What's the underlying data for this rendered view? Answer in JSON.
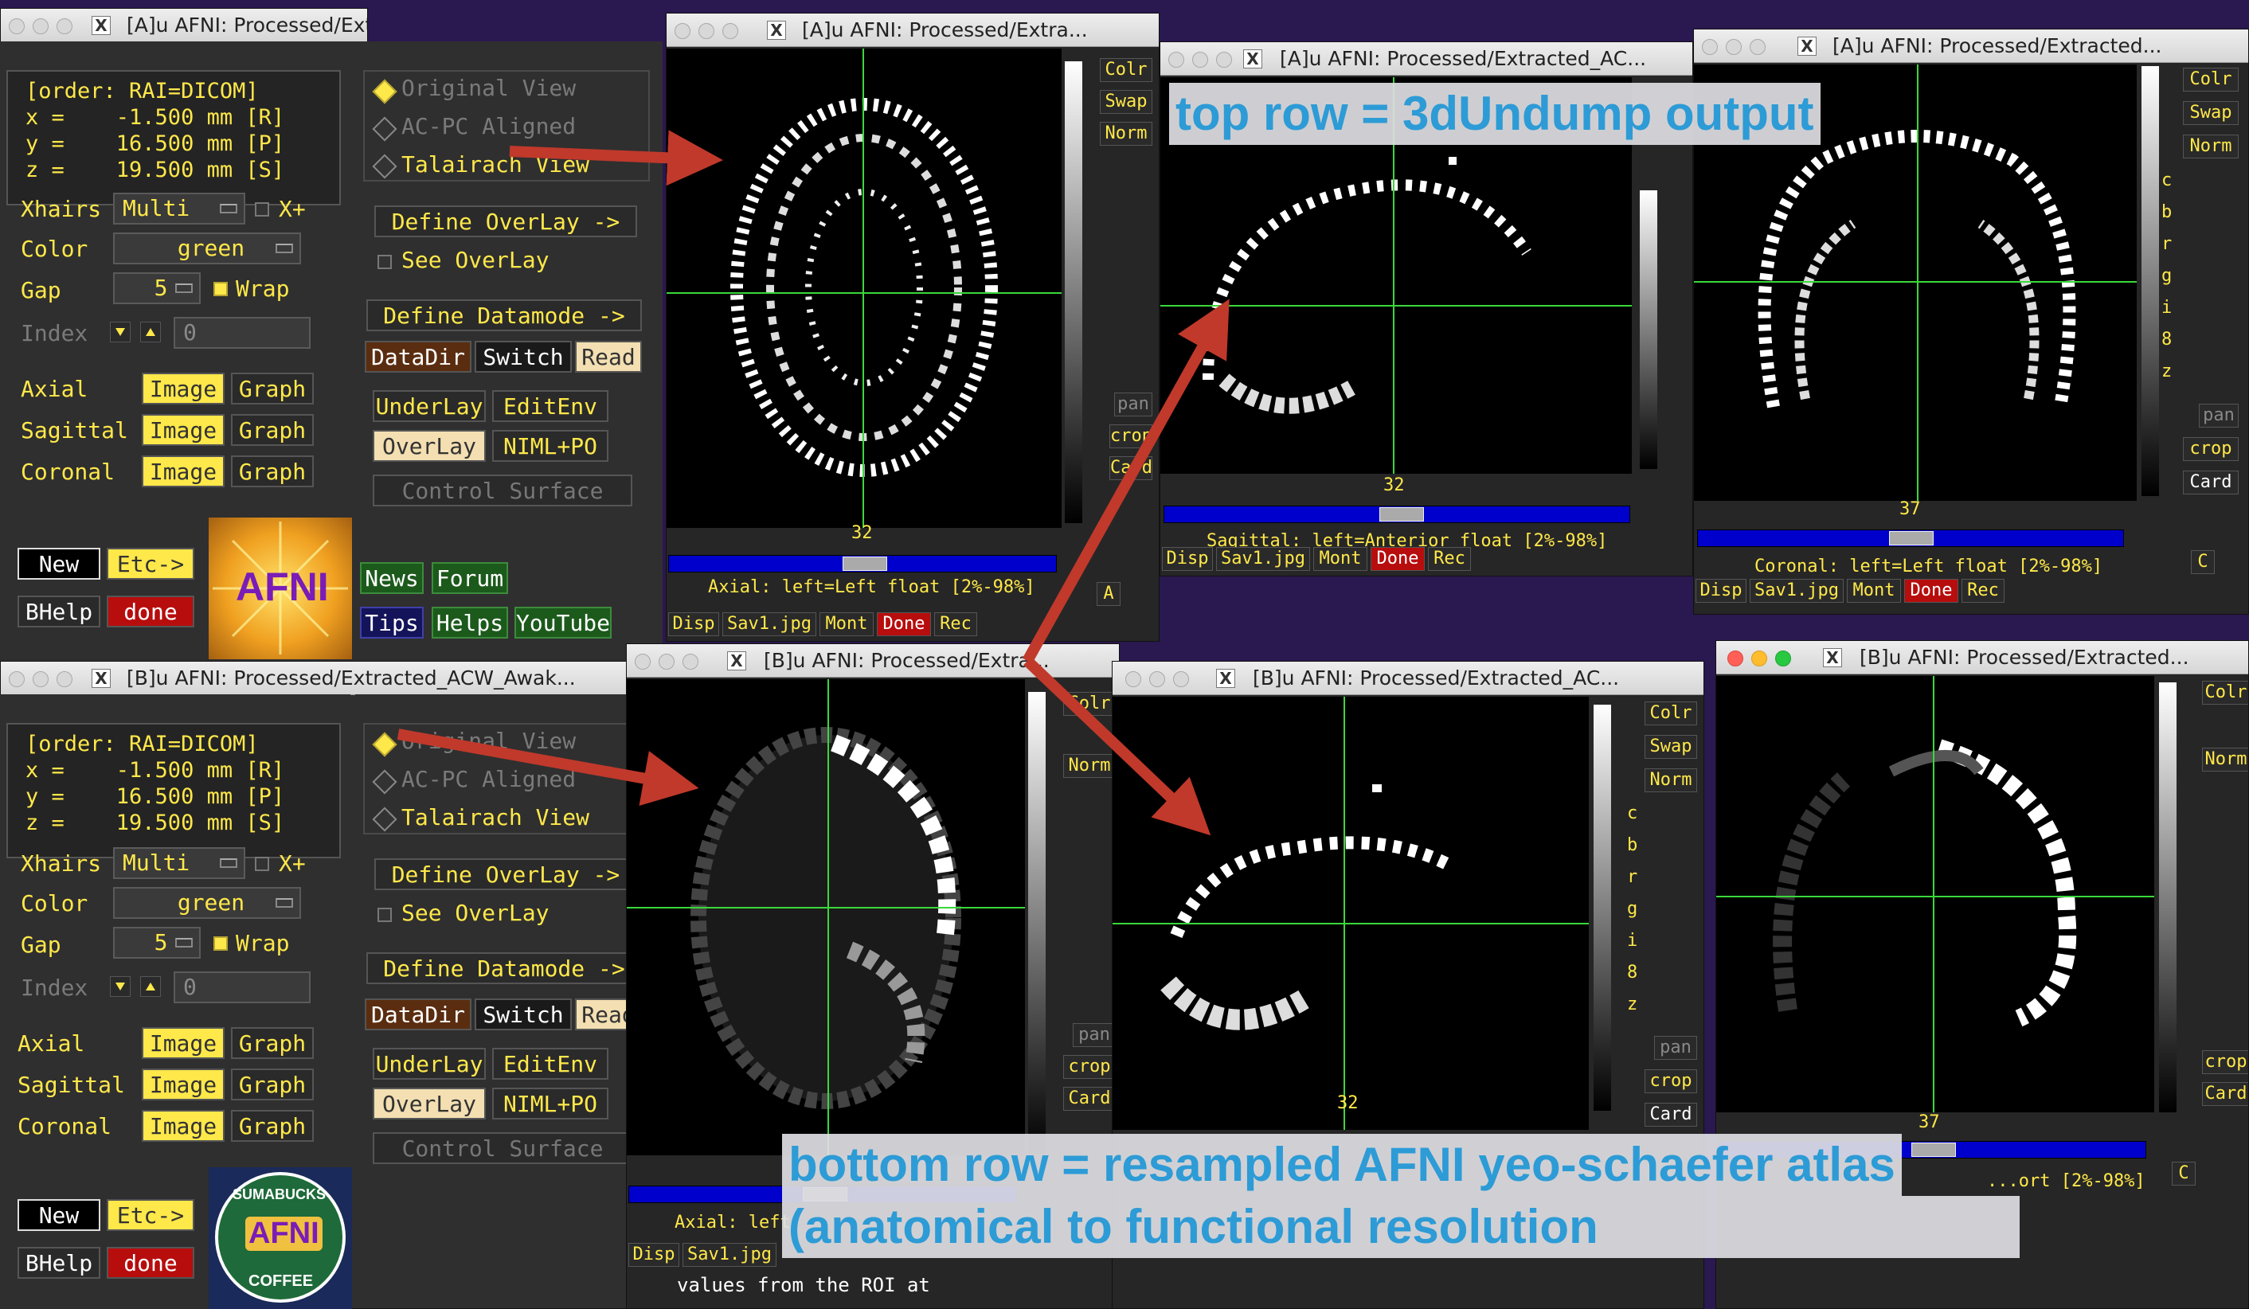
{
  "annotations": {
    "top_row": "top row = 3dUndump output",
    "bottom_row_line1": "bottom row = resampled AFNI yeo-schaefer atlas",
    "bottom_row_line2": "(anatomical to functional resolution"
  },
  "controllers": [
    {
      "title": "[A]u AFNI: Processed/Extracted_ACW_Awak...",
      "coords": "[order: RAI=DICOM]\nx =    -1.500 mm [R]\ny =    16.500 mm [P]\nz =    19.500 mm [S]",
      "xhairs_label": "Xhairs",
      "xhairs_value": "Multi",
      "xplus": "X+",
      "color_label": "Color",
      "color_value": "green",
      "gap_label": "Gap",
      "gap_value": "5",
      "wrap": "Wrap",
      "index_label": "Index",
      "index_value": "0",
      "axial": "Axial",
      "sagittal": "Sagittal",
      "coronal": "Coronal",
      "image": "Image",
      "graph": "Graph",
      "original_view": "Original View",
      "acpc_view": "AC-PC Aligned",
      "talairach_view": "Talairach View",
      "define_overlay": "Define OverLay ->",
      "see_overlay": "See OverLay",
      "define_datamode": "Define Datamode ->",
      "datadir": "DataDir",
      "switch": "Switch",
      "read": "Read",
      "underlay": "UnderLay",
      "editenv": "EditEnv",
      "overlay": "OverLay",
      "niml": "NIML+PO",
      "control_surface": "Control Surface",
      "new": "New",
      "etc": "Etc->",
      "bhelp": "BHelp",
      "done": "done",
      "logo_text": "AFNI"
    },
    {
      "title": "[B]u AFNI: Processed/Extracted_ACW_Awak...",
      "coords": "[order: RAI=DICOM]\nx =    -1.500 mm [R]\ny =    16.500 mm [P]\nz =    19.500 mm [S]",
      "xhairs_label": "Xhairs",
      "xhairs_value": "Multi",
      "xplus": "X+",
      "color_label": "Color",
      "color_value": "green",
      "gap_label": "Gap",
      "gap_value": "5",
      "wrap": "Wrap",
      "index_label": "Index",
      "index_value": "0",
      "axial": "Axial",
      "sagittal": "Sagittal",
      "coronal": "Coronal",
      "image": "Image",
      "graph": "Graph",
      "original_view": "Original View",
      "acpc_view": "AC-PC Aligned",
      "talairach_view": "Talairach View",
      "define_overlay": "Define OverLay ->",
      "see_overlay": "See OverLay",
      "define_datamode": "Define Datamode ->",
      "datadir": "DataDir",
      "switch": "Switch",
      "read": "Read",
      "underlay": "UnderLay",
      "editenv": "EditEnv",
      "overlay": "OverLay",
      "niml": "NIML+PO",
      "control_surface": "Control Surface",
      "new": "New",
      "etc": "Etc->",
      "bhelp": "BHelp",
      "done": "done",
      "logo_top": "SUMABUCKS",
      "logo_mid": "AFNI",
      "logo_bottom": "COFFEE"
    }
  ],
  "help_links": {
    "news": "News",
    "forum": "Forum",
    "tips": "Tips",
    "helps": "Helps",
    "youtube": "YouTube"
  },
  "viewers": [
    {
      "title": "[A]u AFNI: Processed/Extra...",
      "slice": "32",
      "caption": "Axial: left=Left float [2%-98%]"
    },
    {
      "title": "[A]u AFNI: Processed/Extracted_AC...",
      "slice": "32",
      "caption": "Sagittal: left=Anterior float [2%-98%]"
    },
    {
      "title": "[A]u AFNI: Processed/Extracted...",
      "slice": "37",
      "caption": "Coronal: left=Left float [2%-98%]"
    },
    {
      "title": "[B]u AFNI: Processed/Extra...",
      "slice": "",
      "caption": "Axial: left"
    },
    {
      "title": "[B]u AFNI: Processed/Extracted_AC...",
      "slice": "32",
      "caption": ""
    },
    {
      "title": "[B]u AFNI: Processed/Extracted...",
      "slice": "37",
      "caption": "...ort [2%-98%]"
    }
  ],
  "viewer_buttons": {
    "colr": "Colr",
    "swap": "Swap",
    "norm": "Norm",
    "pan": "pan",
    "crop": "crop",
    "card": "Card",
    "disp": "Disp",
    "sav": "Sav1.jpg",
    "mont": "Mont",
    "done": "Done",
    "rec": "Rec",
    "a": "A",
    "c": "C"
  },
  "side_letters": [
    "c",
    "b",
    "r",
    "g",
    "i",
    "8",
    "z"
  ],
  "terminal_text": "values from the ROI at"
}
